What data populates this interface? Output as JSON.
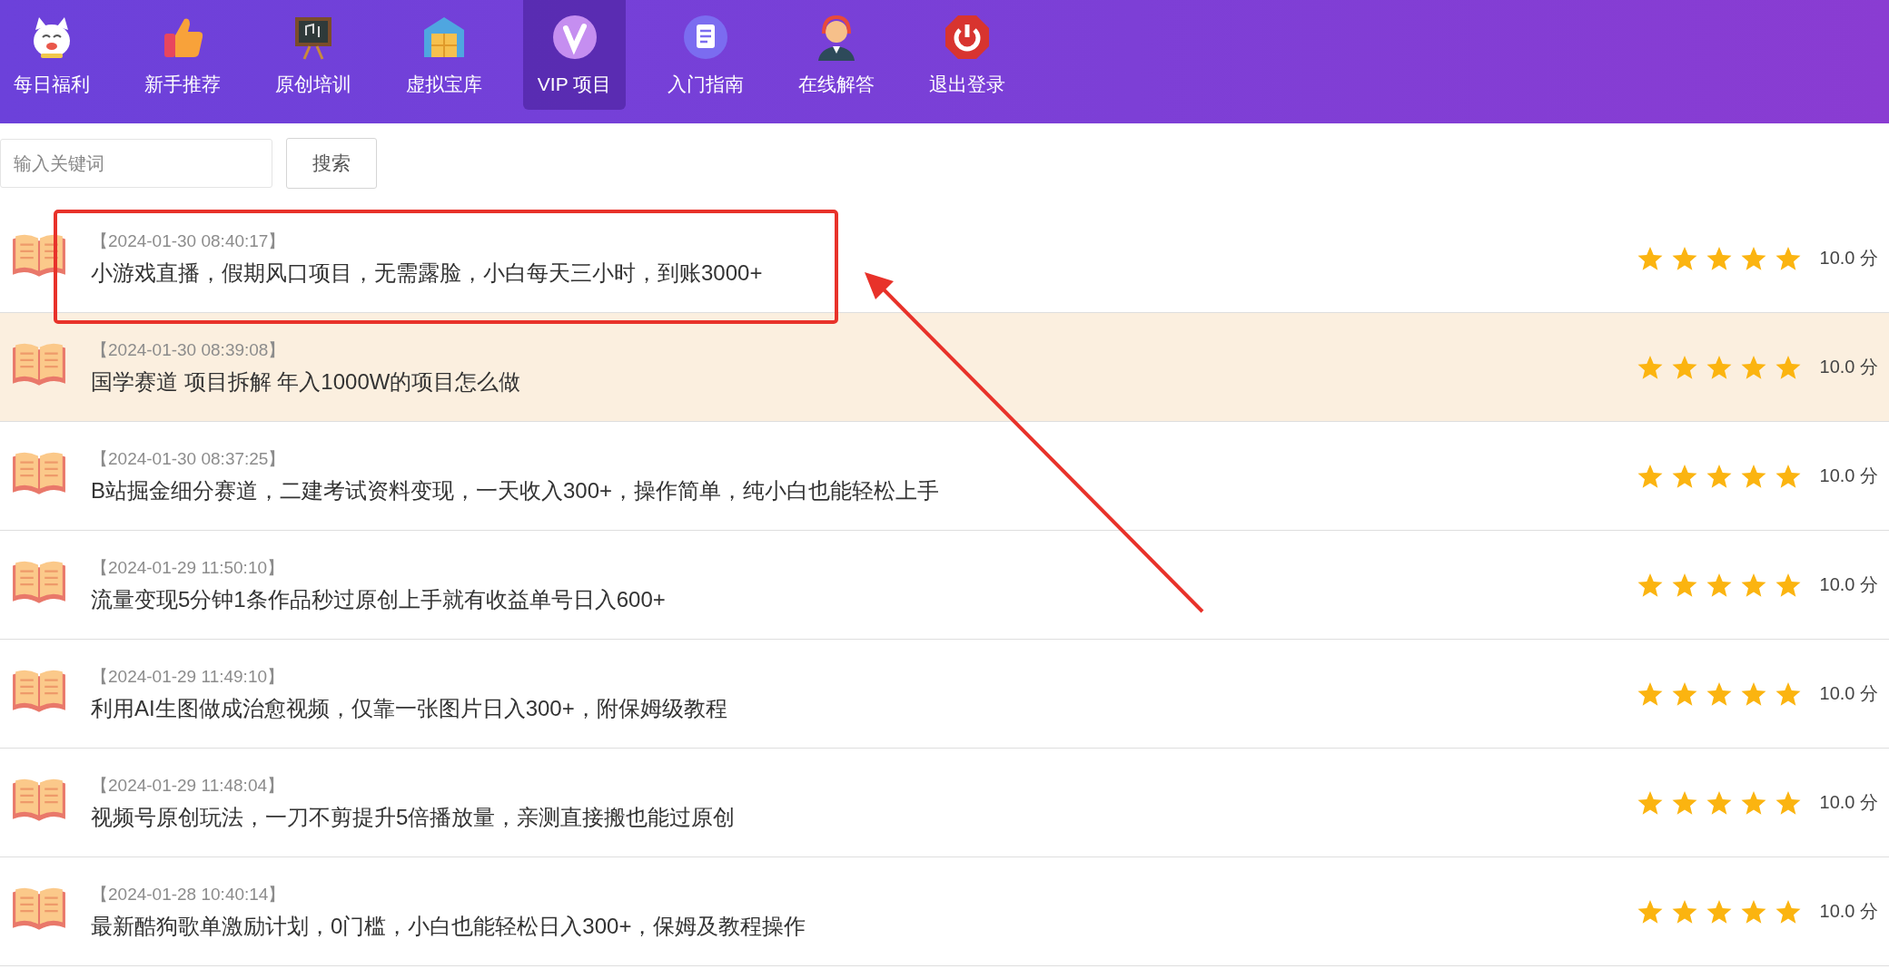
{
  "nav": [
    {
      "label": "每日福利",
      "selected": false
    },
    {
      "label": "新手推荐",
      "selected": false
    },
    {
      "label": "原创培训",
      "selected": false
    },
    {
      "label": "虚拟宝库",
      "selected": false
    },
    {
      "label": "VIP 项目",
      "selected": true
    },
    {
      "label": "入门指南",
      "selected": false
    },
    {
      "label": "在线解答",
      "selected": false
    },
    {
      "label": "退出登录",
      "selected": false
    }
  ],
  "search": {
    "placeholder": "输入关键词",
    "button": "搜索"
  },
  "rows": [
    {
      "date": "【2024-01-30 08:40:17】",
      "title": "小游戏直播，假期风口项目，无需露脸，小白每天三小时，到账3000+",
      "stars": 5,
      "score": "10.0 分",
      "selected": false
    },
    {
      "date": "【2024-01-30 08:39:08】",
      "title": "国学赛道 项目拆解 年入1000W的项目怎么做",
      "stars": 5,
      "score": "10.0 分",
      "selected": true
    },
    {
      "date": "【2024-01-30 08:37:25】",
      "title": "B站掘金细分赛道，二建考试资料变现，一天收入300+，操作简单，纯小白也能轻松上手",
      "stars": 5,
      "score": "10.0 分",
      "selected": false
    },
    {
      "date": "【2024-01-29 11:50:10】",
      "title": "流量变现5分钟1条作品秒过原创上手就有收益单号日入600+",
      "stars": 5,
      "score": "10.0 分",
      "selected": false
    },
    {
      "date": "【2024-01-29 11:49:10】",
      "title": "利用AI生图做成治愈视频，仅靠一张图片日入300+，附保姆级教程",
      "stars": 5,
      "score": "10.0 分",
      "selected": false
    },
    {
      "date": "【2024-01-29 11:48:04】",
      "title": "视频号原创玩法，一刀不剪提升5倍播放量，亲测直接搬也能过原创",
      "stars": 5,
      "score": "10.0 分",
      "selected": false
    },
    {
      "date": "【2024-01-28 10:40:14】",
      "title": "最新酷狗歌单激励计划，0门槛，小白也能轻松日入300+，保姆及教程操作",
      "stars": 5,
      "score": "10.0 分",
      "selected": false
    }
  ]
}
